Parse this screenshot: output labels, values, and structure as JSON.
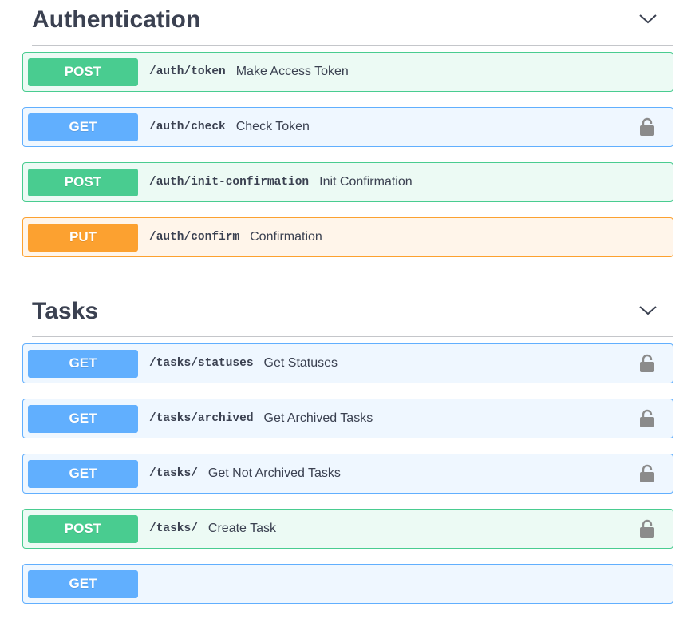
{
  "sections": [
    {
      "title": "Authentication",
      "operations": [
        {
          "method": "POST",
          "path": "/auth/token",
          "summary": "Make Access Token",
          "locked": false
        },
        {
          "method": "GET",
          "path": "/auth/check",
          "summary": "Check Token",
          "locked": true
        },
        {
          "method": "POST",
          "path": "/auth/init-confirmation",
          "summary": "Init Confirmation",
          "locked": false
        },
        {
          "method": "PUT",
          "path": "/auth/confirm",
          "summary": "Confirmation",
          "locked": false
        }
      ]
    },
    {
      "title": "Tasks",
      "operations": [
        {
          "method": "GET",
          "path": "/tasks/statuses",
          "summary": "Get Statuses",
          "locked": true
        },
        {
          "method": "GET",
          "path": "/tasks/archived",
          "summary": "Get Archived Tasks",
          "locked": true
        },
        {
          "method": "GET",
          "path": "/tasks/",
          "summary": "Get Not Archived Tasks",
          "locked": true
        },
        {
          "method": "POST",
          "path": "/tasks/",
          "summary": "Create Task",
          "locked": true
        },
        {
          "method": "GET",
          "path": "",
          "summary": "",
          "locked": false
        }
      ]
    }
  ],
  "colors": {
    "post": "#49cc90",
    "get": "#61affe",
    "put": "#fca130",
    "text": "#3b4151",
    "lock": "#8b8b8b"
  },
  "icons": {
    "expand": "chevron-down-icon",
    "lock": "lock-icon"
  }
}
